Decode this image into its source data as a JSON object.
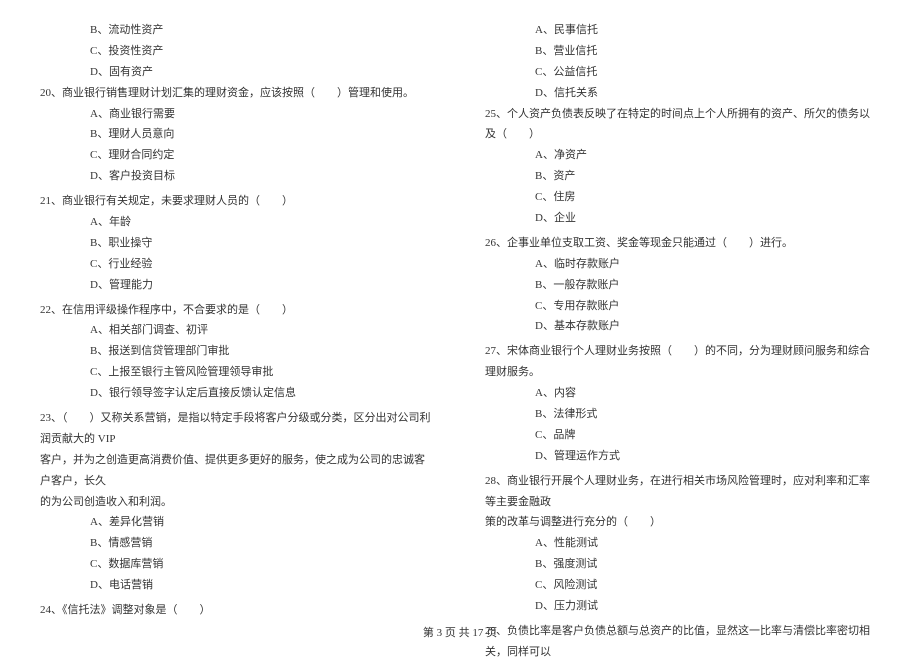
{
  "left": {
    "pre_options": [
      "B、流动性资产",
      "C、投资性资产",
      "D、固有资产"
    ],
    "questions": [
      {
        "num": "20、",
        "stem": "商业银行销售理财计划汇集的理财资金，应该按照（　　）管理和使用。",
        "options": [
          "A、商业银行需要",
          "B、理财人员意向",
          "C、理财合同约定",
          "D、客户投资目标"
        ]
      },
      {
        "num": "21、",
        "stem": "商业银行有关规定，未要求理财人员的（　　）",
        "options": [
          "A、年龄",
          "B、职业操守",
          "C、行业经验",
          "D、管理能力"
        ]
      },
      {
        "num": "22、",
        "stem": "在信用评级操作程序中，不合要求的是（　　）",
        "options": [
          "A、相关部门调查、初评",
          "B、报送到信贷管理部门审批",
          "C、上报至银行主管风险管理领导审批",
          "D、银行领导签字认定后直接反馈认定信息"
        ]
      },
      {
        "num": "23、",
        "stem": "（　　）又称关系营销，是指以特定手段将客户分级或分类，区分出对公司利润贡献大的 VIP",
        "stem_cont": [
          "客户，并为之创造更高消费价值、提供更多更好的服务，使之成为公司的忠诚客户客户，长久",
          "的为公司创造收入和利润。"
        ],
        "options": [
          "A、差异化营销",
          "B、情感营销",
          "C、数据库营销",
          "D、电话营销"
        ]
      },
      {
        "num": "24、",
        "stem": "《信托法》调整对象是（　　）",
        "options": []
      }
    ]
  },
  "right": {
    "pre_options": [
      "A、民事信托",
      "B、营业信托",
      "C、公益信托",
      "D、信托关系"
    ],
    "questions": [
      {
        "num": "25、",
        "stem": "个人资产负债表反映了在特定的时间点上个人所拥有的资产、所欠的债务以及（　　）",
        "options": [
          "A、净资产",
          "B、资产",
          "C、住房",
          "D、企业"
        ]
      },
      {
        "num": "26、",
        "stem": "企事业单位支取工资、奖金等现金只能通过（　　）进行。",
        "options": [
          "A、临时存款账户",
          "B、一般存款账户",
          "C、专用存款账户",
          "D、基本存款账户"
        ]
      },
      {
        "num": "27、",
        "stem": "宋体商业银行个人理财业务按照（　　）的不同，分为理财顾问服务和综合理财服务。",
        "options": [
          "A、内容",
          "B、法律形式",
          "C、品牌",
          "D、管理运作方式"
        ]
      },
      {
        "num": "28、",
        "stem": "商业银行开展个人理财业务，在进行相关市场风险管理时，应对利率和汇率等主要金融政",
        "stem_cont": [
          "策的改革与调整进行充分的（　　）"
        ],
        "options": [
          "A、性能测试",
          "B、强度测试",
          "C、风险测试",
          "D、压力测试"
        ]
      },
      {
        "num": "29、",
        "stem": "负债比率是客户负债总额与总资产的比值，显然这一比率与清偿比率密切相关，同样可以",
        "options": []
      }
    ]
  },
  "footer": "第 3 页 共 17 页"
}
